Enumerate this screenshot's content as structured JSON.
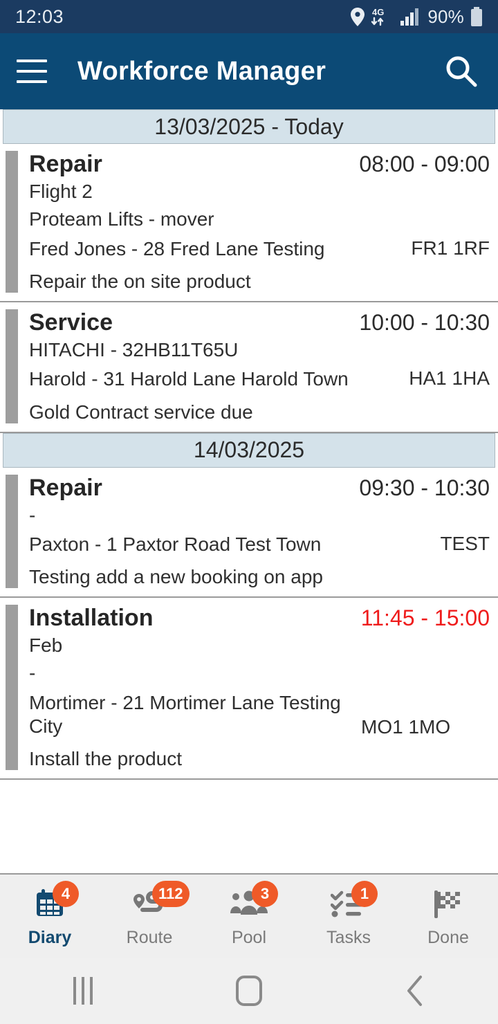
{
  "status_bar": {
    "time": "12:03",
    "battery_percent": "90%",
    "network": "4G",
    "icons": [
      "location-pin-icon",
      "network-4g-icon",
      "signal-bars-icon",
      "battery-icon"
    ]
  },
  "toolbar": {
    "title": "Workforce Manager",
    "menu_icon": "hamburger-menu-icon",
    "search_icon": "search-icon",
    "background_color": "#0c4a76"
  },
  "groups": [
    {
      "date_label": "13/03/2025 - Today",
      "jobs": [
        {
          "type": "Repair",
          "time": "08:00 - 09:00",
          "time_alert": false,
          "sub1": "Flight 2",
          "sub2": "Proteam Lifts - mover",
          "address": "Fred Jones - 28 Fred Lane  Testing",
          "postcode": "FR1 1RF",
          "note": "Repair the on site product"
        },
        {
          "type": "Service",
          "time": "10:00 - 10:30",
          "time_alert": false,
          "sub1": "HITACHI - 32HB11T65U",
          "sub2": "",
          "address": "Harold - 31 Harold Lane    Harold Town",
          "postcode": "HA1 1HA",
          "note": "Gold Contract service due"
        }
      ]
    },
    {
      "date_label": "14/03/2025",
      "jobs": [
        {
          "type": "Repair",
          "time": "09:30 - 10:30",
          "time_alert": false,
          "sub1": "-",
          "sub2": "",
          "address": "Paxton - 1 Paxtor Road  Test Town",
          "postcode": "TEST",
          "note": "Testing add a new booking on app"
        },
        {
          "type": "Installation",
          "time": "11:45 - 15:00",
          "time_alert": true,
          "sub1": "Feb",
          "sub2": "-",
          "address": "Mortimer - 21 Mortimer Lane  Testing City",
          "postcode": "MO1 1MO",
          "note": "Install the product"
        }
      ]
    }
  ],
  "bottom_nav": {
    "active": "Diary",
    "items": [
      {
        "label": "Diary",
        "badge": "4",
        "icon": "calendar-icon",
        "active": true
      },
      {
        "label": "Route",
        "badge": "112",
        "icon": "route-map-icon",
        "active": false
      },
      {
        "label": "Pool",
        "badge": "3",
        "icon": "people-group-icon",
        "active": false
      },
      {
        "label": "Tasks",
        "badge": "1",
        "icon": "checklist-icon",
        "active": false
      },
      {
        "label": "Done",
        "badge": "",
        "icon": "checkered-flag-icon",
        "active": false
      }
    ],
    "badge_color": "#ef5a28",
    "active_color": "#134a70"
  },
  "android_nav": {
    "recents": "recents-icon",
    "home": "home-icon",
    "back": "back-icon"
  }
}
